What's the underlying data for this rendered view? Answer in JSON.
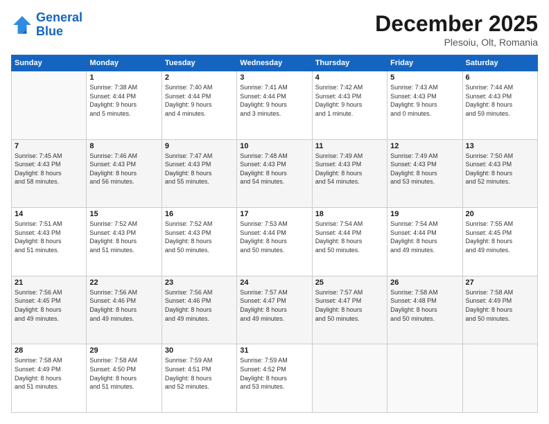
{
  "logo": {
    "line1": "General",
    "line2": "Blue"
  },
  "title": "December 2025",
  "location": "Plesoiu, Olt, Romania",
  "days_of_week": [
    "Sunday",
    "Monday",
    "Tuesday",
    "Wednesday",
    "Thursday",
    "Friday",
    "Saturday"
  ],
  "weeks": [
    [
      {
        "day": "",
        "info": ""
      },
      {
        "day": "1",
        "info": "Sunrise: 7:38 AM\nSunset: 4:44 PM\nDaylight: 9 hours\nand 5 minutes."
      },
      {
        "day": "2",
        "info": "Sunrise: 7:40 AM\nSunset: 4:44 PM\nDaylight: 9 hours\nand 4 minutes."
      },
      {
        "day": "3",
        "info": "Sunrise: 7:41 AM\nSunset: 4:44 PM\nDaylight: 9 hours\nand 3 minutes."
      },
      {
        "day": "4",
        "info": "Sunrise: 7:42 AM\nSunset: 4:43 PM\nDaylight: 9 hours\nand 1 minute."
      },
      {
        "day": "5",
        "info": "Sunrise: 7:43 AM\nSunset: 4:43 PM\nDaylight: 9 hours\nand 0 minutes."
      },
      {
        "day": "6",
        "info": "Sunrise: 7:44 AM\nSunset: 4:43 PM\nDaylight: 8 hours\nand 59 minutes."
      }
    ],
    [
      {
        "day": "7",
        "info": "Sunrise: 7:45 AM\nSunset: 4:43 PM\nDaylight: 8 hours\nand 58 minutes."
      },
      {
        "day": "8",
        "info": "Sunrise: 7:46 AM\nSunset: 4:43 PM\nDaylight: 8 hours\nand 56 minutes."
      },
      {
        "day": "9",
        "info": "Sunrise: 7:47 AM\nSunset: 4:43 PM\nDaylight: 8 hours\nand 55 minutes."
      },
      {
        "day": "10",
        "info": "Sunrise: 7:48 AM\nSunset: 4:43 PM\nDaylight: 8 hours\nand 54 minutes."
      },
      {
        "day": "11",
        "info": "Sunrise: 7:49 AM\nSunset: 4:43 PM\nDaylight: 8 hours\nand 54 minutes."
      },
      {
        "day": "12",
        "info": "Sunrise: 7:49 AM\nSunset: 4:43 PM\nDaylight: 8 hours\nand 53 minutes."
      },
      {
        "day": "13",
        "info": "Sunrise: 7:50 AM\nSunset: 4:43 PM\nDaylight: 8 hours\nand 52 minutes."
      }
    ],
    [
      {
        "day": "14",
        "info": "Sunrise: 7:51 AM\nSunset: 4:43 PM\nDaylight: 8 hours\nand 51 minutes."
      },
      {
        "day": "15",
        "info": "Sunrise: 7:52 AM\nSunset: 4:43 PM\nDaylight: 8 hours\nand 51 minutes."
      },
      {
        "day": "16",
        "info": "Sunrise: 7:52 AM\nSunset: 4:43 PM\nDaylight: 8 hours\nand 50 minutes."
      },
      {
        "day": "17",
        "info": "Sunrise: 7:53 AM\nSunset: 4:44 PM\nDaylight: 8 hours\nand 50 minutes."
      },
      {
        "day": "18",
        "info": "Sunrise: 7:54 AM\nSunset: 4:44 PM\nDaylight: 8 hours\nand 50 minutes."
      },
      {
        "day": "19",
        "info": "Sunrise: 7:54 AM\nSunset: 4:44 PM\nDaylight: 8 hours\nand 49 minutes."
      },
      {
        "day": "20",
        "info": "Sunrise: 7:55 AM\nSunset: 4:45 PM\nDaylight: 8 hours\nand 49 minutes."
      }
    ],
    [
      {
        "day": "21",
        "info": "Sunrise: 7:56 AM\nSunset: 4:45 PM\nDaylight: 8 hours\nand 49 minutes."
      },
      {
        "day": "22",
        "info": "Sunrise: 7:56 AM\nSunset: 4:46 PM\nDaylight: 8 hours\nand 49 minutes."
      },
      {
        "day": "23",
        "info": "Sunrise: 7:56 AM\nSunset: 4:46 PM\nDaylight: 8 hours\nand 49 minutes."
      },
      {
        "day": "24",
        "info": "Sunrise: 7:57 AM\nSunset: 4:47 PM\nDaylight: 8 hours\nand 49 minutes."
      },
      {
        "day": "25",
        "info": "Sunrise: 7:57 AM\nSunset: 4:47 PM\nDaylight: 8 hours\nand 50 minutes."
      },
      {
        "day": "26",
        "info": "Sunrise: 7:58 AM\nSunset: 4:48 PM\nDaylight: 8 hours\nand 50 minutes."
      },
      {
        "day": "27",
        "info": "Sunrise: 7:58 AM\nSunset: 4:49 PM\nDaylight: 8 hours\nand 50 minutes."
      }
    ],
    [
      {
        "day": "28",
        "info": "Sunrise: 7:58 AM\nSunset: 4:49 PM\nDaylight: 8 hours\nand 51 minutes."
      },
      {
        "day": "29",
        "info": "Sunrise: 7:58 AM\nSunset: 4:50 PM\nDaylight: 8 hours\nand 51 minutes."
      },
      {
        "day": "30",
        "info": "Sunrise: 7:59 AM\nSunset: 4:51 PM\nDaylight: 8 hours\nand 52 minutes."
      },
      {
        "day": "31",
        "info": "Sunrise: 7:59 AM\nSunset: 4:52 PM\nDaylight: 8 hours\nand 53 minutes."
      },
      {
        "day": "",
        "info": ""
      },
      {
        "day": "",
        "info": ""
      },
      {
        "day": "",
        "info": ""
      }
    ]
  ]
}
